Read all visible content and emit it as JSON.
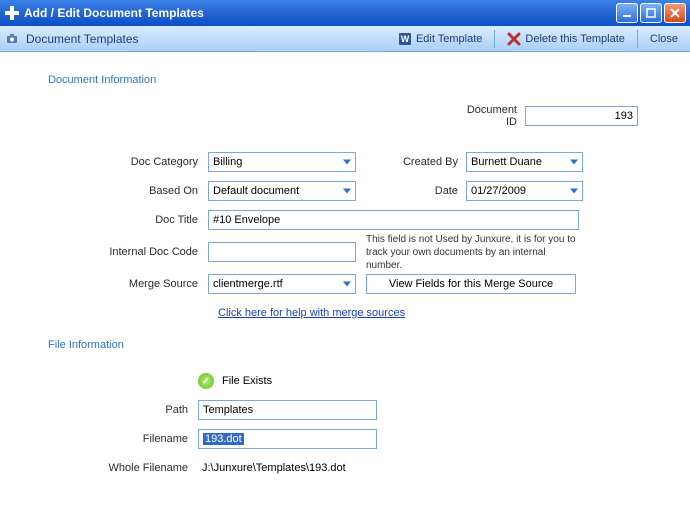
{
  "window": {
    "title": "Add / Edit Document Templates"
  },
  "toolbar": {
    "title": "Document Templates",
    "edit_template": "Edit Template",
    "delete_template": "Delete this Template",
    "close": "Close"
  },
  "sections": {
    "doc_info": "Document Information",
    "file_info": "File Information"
  },
  "labels": {
    "document_id": "Document ID",
    "doc_category": "Doc Category",
    "created_by": "Created By",
    "based_on": "Based On",
    "date": "Date",
    "doc_title": "Doc Title",
    "internal_doc_code": "Internal Doc Code",
    "merge_source": "Merge Source",
    "file_exists": "File Exists",
    "path": "Path",
    "filename": "Filename",
    "whole_filename": "Whole Filename"
  },
  "values": {
    "document_id": "193",
    "doc_category": "Billing",
    "created_by": "Burnett Duane",
    "based_on": "Default document",
    "date": "01/27/2009",
    "doc_title": "#10 Envelope",
    "internal_doc_code": "",
    "merge_source": "clientmerge.rtf",
    "path": "Templates",
    "filename": "193.dot",
    "whole_filename": "J:\\Junxure\\Templates\\193.dot"
  },
  "hints": {
    "internal_doc_code": "This field is not Used by Junxure, it is for you to track your own documents by an internal number."
  },
  "buttons": {
    "view_fields": "View Fields for this Merge Source"
  },
  "links": {
    "merge_help": "Click here for help with merge sources"
  }
}
